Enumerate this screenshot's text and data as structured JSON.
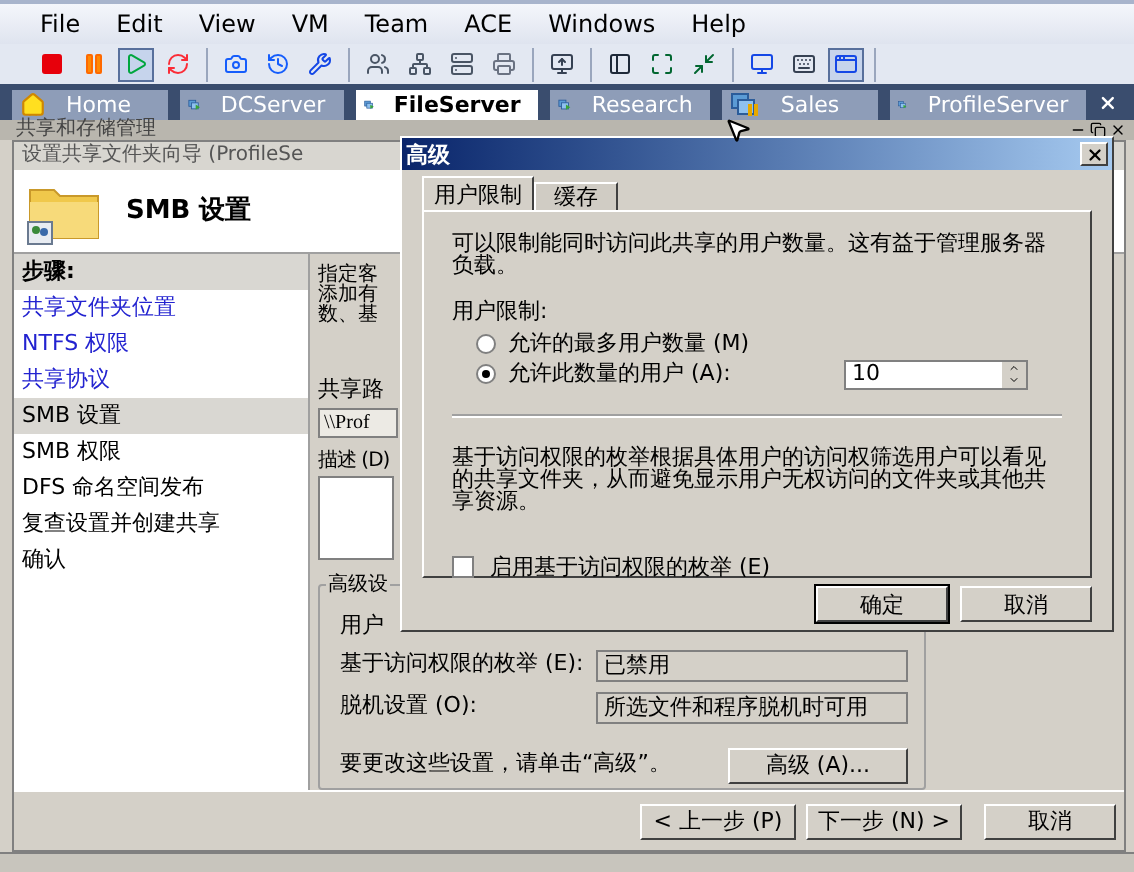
{
  "menu": [
    "File",
    "Edit",
    "View",
    "VM",
    "Team",
    "ACE",
    "Windows",
    "Help"
  ],
  "toolbar": [
    [
      {
        "kind": "stop",
        "pressed": false
      },
      {
        "kind": "pause",
        "pressed": false
      },
      {
        "kind": "play",
        "pressed": true
      },
      {
        "kind": "reset",
        "pressed": false
      }
    ],
    [
      {
        "kind": "snapshot",
        "pressed": false
      },
      {
        "kind": "revert",
        "pressed": false
      },
      {
        "kind": "manager",
        "pressed": false
      }
    ],
    [
      {
        "kind": "team",
        "pressed": false
      },
      {
        "kind": "network",
        "pressed": false
      },
      {
        "kind": "server",
        "pressed": false
      },
      {
        "kind": "printer",
        "pressed": false
      }
    ],
    [
      {
        "kind": "console",
        "pressed": false
      }
    ],
    [
      {
        "kind": "sidebar",
        "pressed": false
      },
      {
        "kind": "fullscreen",
        "pressed": false
      },
      {
        "kind": "fit",
        "pressed": false
      }
    ],
    [
      {
        "kind": "display",
        "pressed": false
      },
      {
        "kind": "keyboard",
        "pressed": false
      },
      {
        "kind": "quickswitch",
        "pressed": true
      }
    ]
  ],
  "tabs": [
    {
      "label": "Home",
      "kind": "home",
      "selected": false
    },
    {
      "label": "DCServer",
      "kind": "running",
      "selected": false
    },
    {
      "label": "FileServer",
      "kind": "running",
      "selected": true
    },
    {
      "label": "Research",
      "kind": "running",
      "selected": false
    },
    {
      "label": "Sales",
      "kind": "paused",
      "selected": false
    },
    {
      "label": "ProfileServer",
      "kind": "running",
      "selected": false
    }
  ],
  "host_window": {
    "title": "共享和存储管理"
  },
  "wizard": {
    "title": "设置共享文件夹向导 (ProfileSe",
    "heading": "SMB 设置",
    "steps_label": "步骤:",
    "steps": [
      {
        "label": "共享文件夹位置",
        "done": true,
        "selected": false
      },
      {
        "label": "NTFS 权限",
        "done": true,
        "selected": false
      },
      {
        "label": "共享协议",
        "done": true,
        "selected": false
      },
      {
        "label": "SMB 设置",
        "done": false,
        "selected": true
      },
      {
        "label": "SMB 权限",
        "done": false,
        "selected": false
      },
      {
        "label": "DFS 命名空间发布",
        "done": false,
        "selected": false
      },
      {
        "label": "复查设置并创建共享",
        "done": false,
        "selected": false
      },
      {
        "label": "确认",
        "done": false,
        "selected": false
      }
    ],
    "intro_lines": [
      "指定客",
      "添加有",
      "数、基"
    ],
    "path_label": "共享路",
    "path_value": "\\\\Prof",
    "description_label": "描述 (D)",
    "group_label": "高级设",
    "user_limit_label": "用户",
    "rows": [
      {
        "label": "基于访问权限的枚举 (E):",
        "value": "已禁用"
      },
      {
        "label": "脱机设置 (O):",
        "value": "所选文件和程序脱机时可用"
      }
    ],
    "note": "要更改这些设置，请单击“高级”。",
    "advanced_button": "高级 (A)...",
    "buttons": [
      "< 上一步 (P)",
      "下一步 (N) >",
      "取消"
    ]
  },
  "dialog": {
    "title": "高级",
    "tabs": [
      {
        "label": "用户限制",
        "selected": true
      },
      {
        "label": "缓存",
        "selected": false
      }
    ],
    "intro": "可以限制能同时访问此共享的用户数量。这有益于管理服务器负载。",
    "limit_label": "用户限制:",
    "options": [
      {
        "label": "允许的最多用户数量 (M)",
        "selected": false
      },
      {
        "label": "允许此数量的用户 (A):",
        "selected": true
      }
    ],
    "count": "10",
    "abe_text": "基于访问权限的枚举根据具体用户的访问权筛选用户可以看见的共享文件夹，从而避免显示用户无权访问的文件夹或其他共享资源。",
    "checkbox": {
      "label": "启用基于访问权限的枚举 (E)",
      "checked": false
    },
    "buttons": [
      "确定",
      "取消"
    ]
  }
}
